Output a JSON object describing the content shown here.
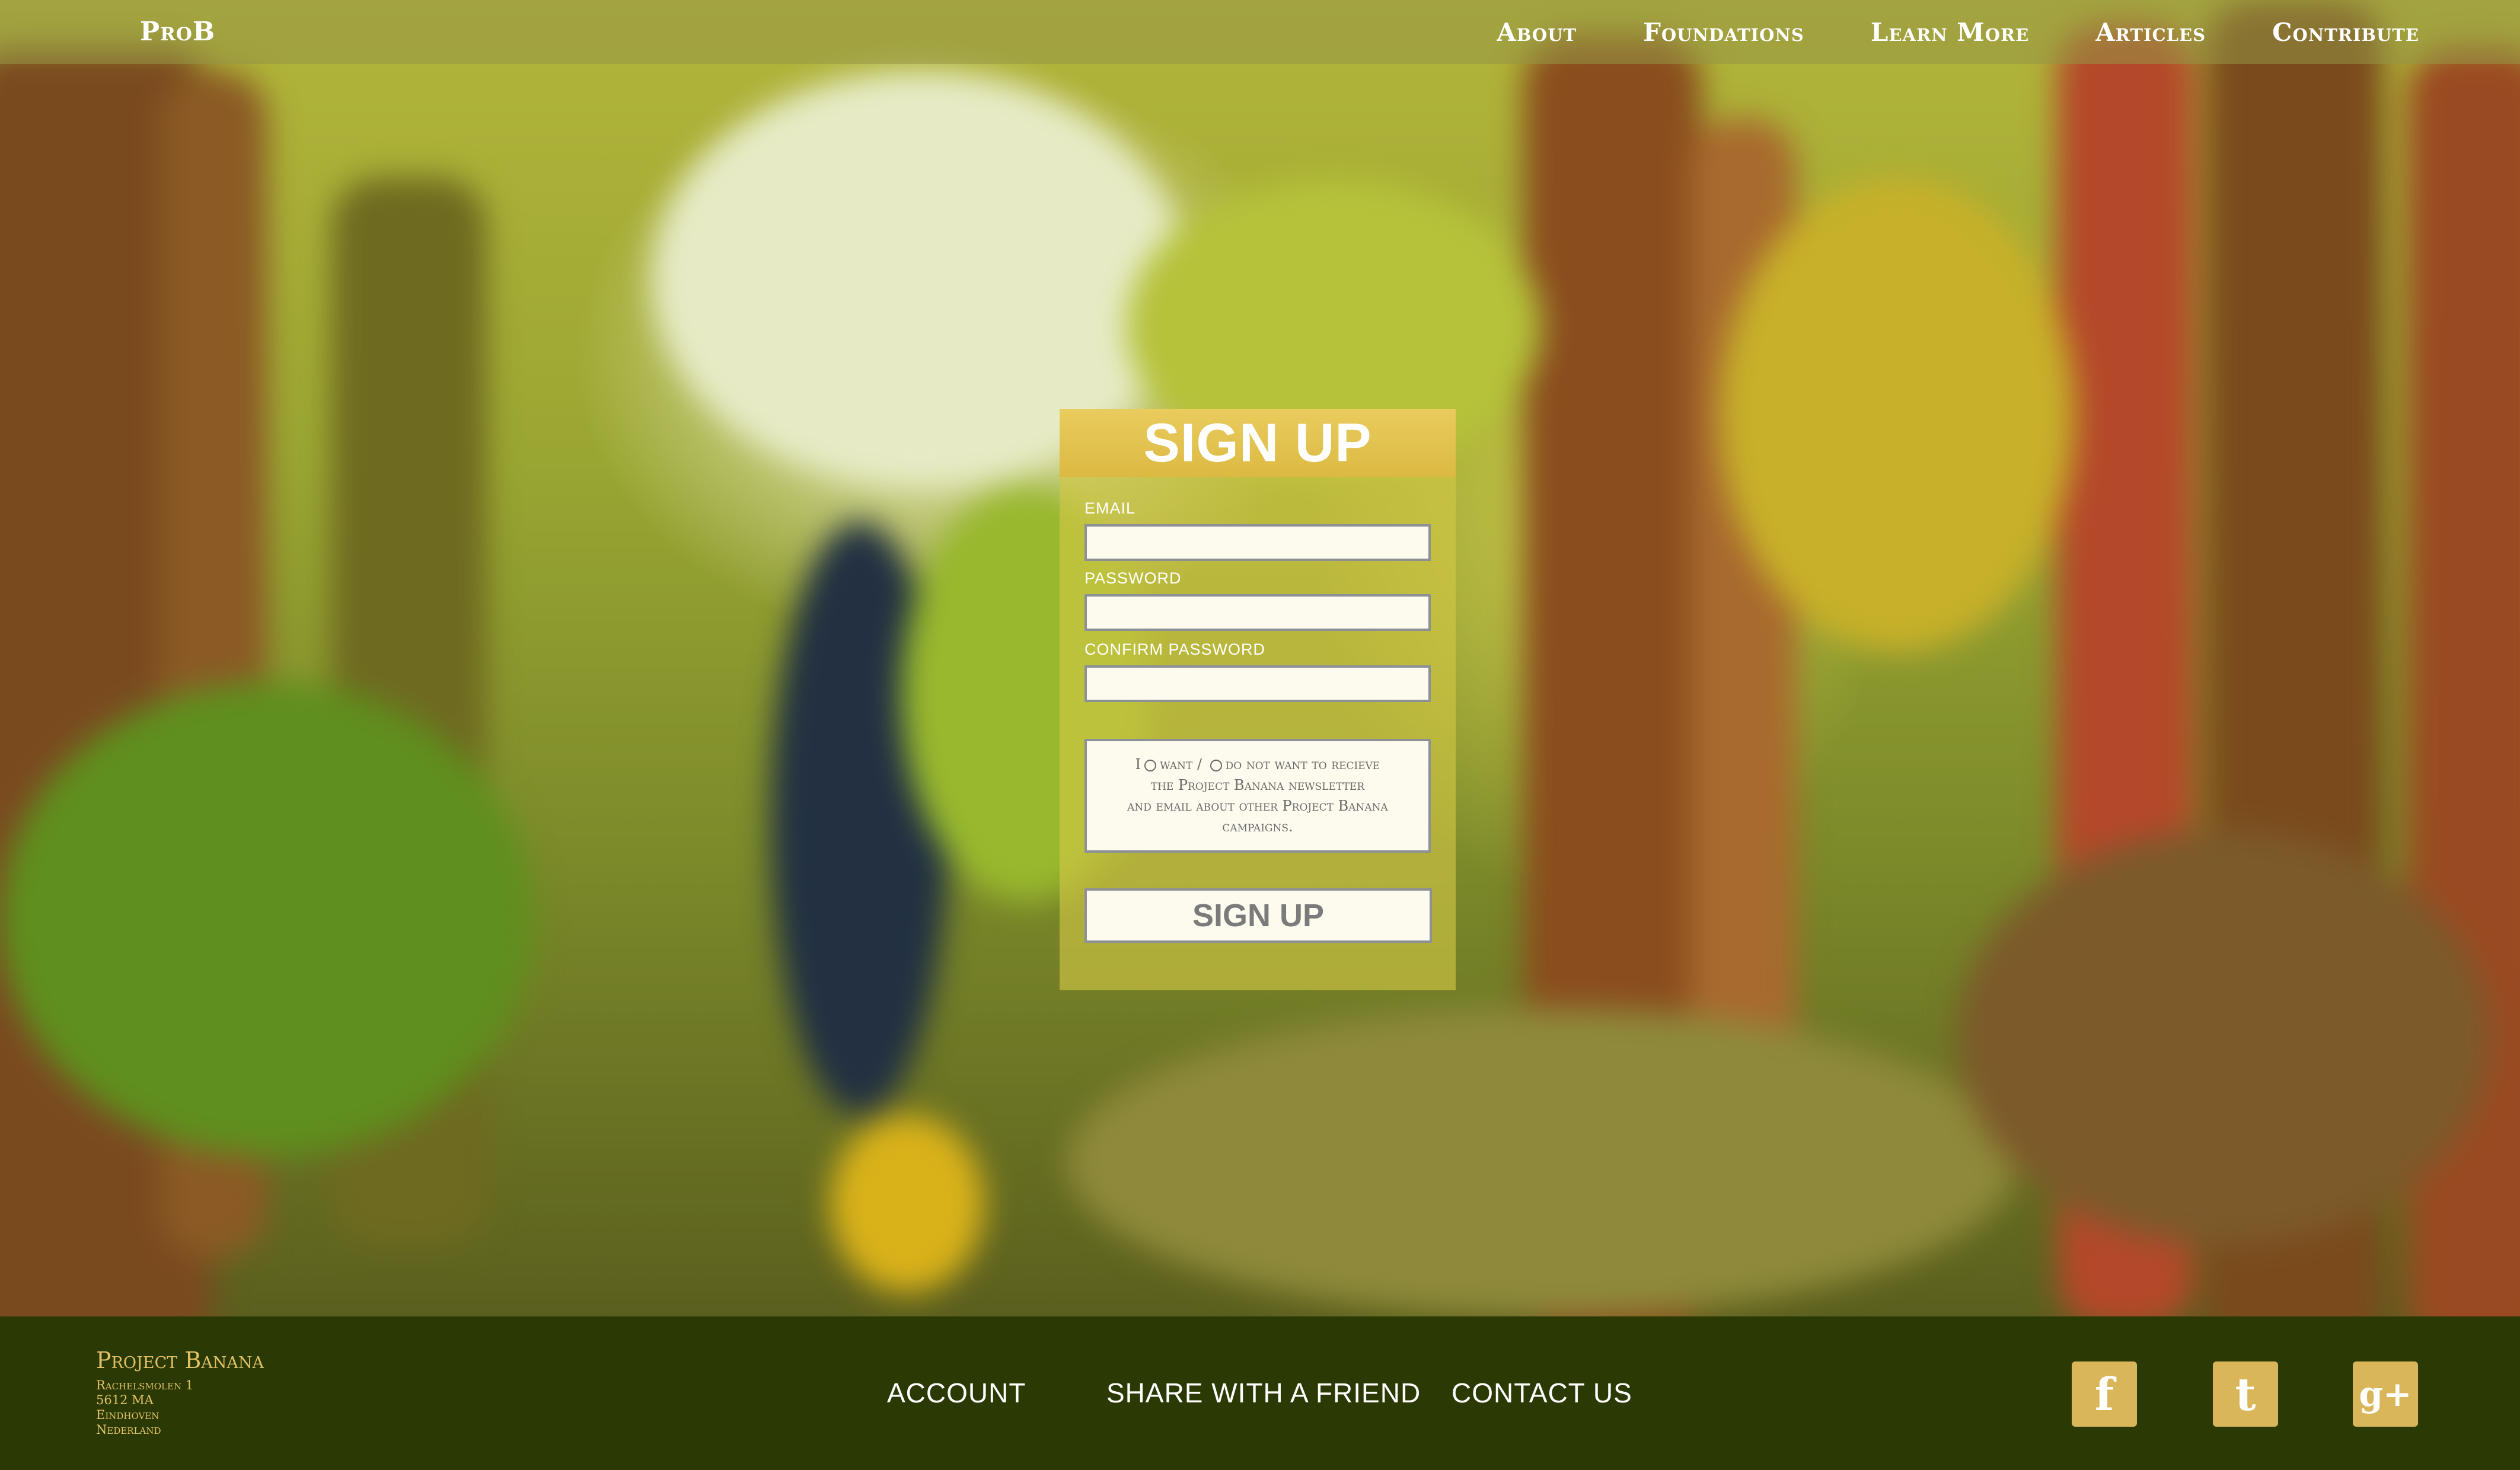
{
  "site": {
    "brand": "ProB"
  },
  "nav": {
    "items": [
      "About",
      "Foundations",
      "Learn More",
      "Articles",
      "Contribute"
    ]
  },
  "signup": {
    "title": "SIGN UP",
    "email_label": "EMAIL",
    "password_label": "PASSWORD",
    "confirm_label": "CONFIRM PASSWORD",
    "newsletter": {
      "prefix": "I",
      "want": "want /",
      "do_not_want": "do not want",
      "rest_line1": "to recieve",
      "line2": "the Project Banana newsletter",
      "line3": "and email about other Project Banana",
      "line4": "campaigns."
    },
    "submit_label": "SIGN UP"
  },
  "footer": {
    "org_name": "Project Banana",
    "address": [
      "Rachelsmolen 1",
      "5612 MA",
      "Eindhoven",
      "Nederland"
    ],
    "links": [
      "ACCOUNT",
      "SHARE WITH A FRIEND",
      "CONTACT US"
    ],
    "social": [
      {
        "name": "facebook-icon",
        "glyph": "f"
      },
      {
        "name": "twitter-icon",
        "glyph": "t"
      },
      {
        "name": "google-plus-icon",
        "glyph": "g+"
      }
    ]
  },
  "colors": {
    "accent_gold": "#e3c266",
    "footer_bg": "#2b3a04",
    "panel_header": "#e2c24d"
  }
}
